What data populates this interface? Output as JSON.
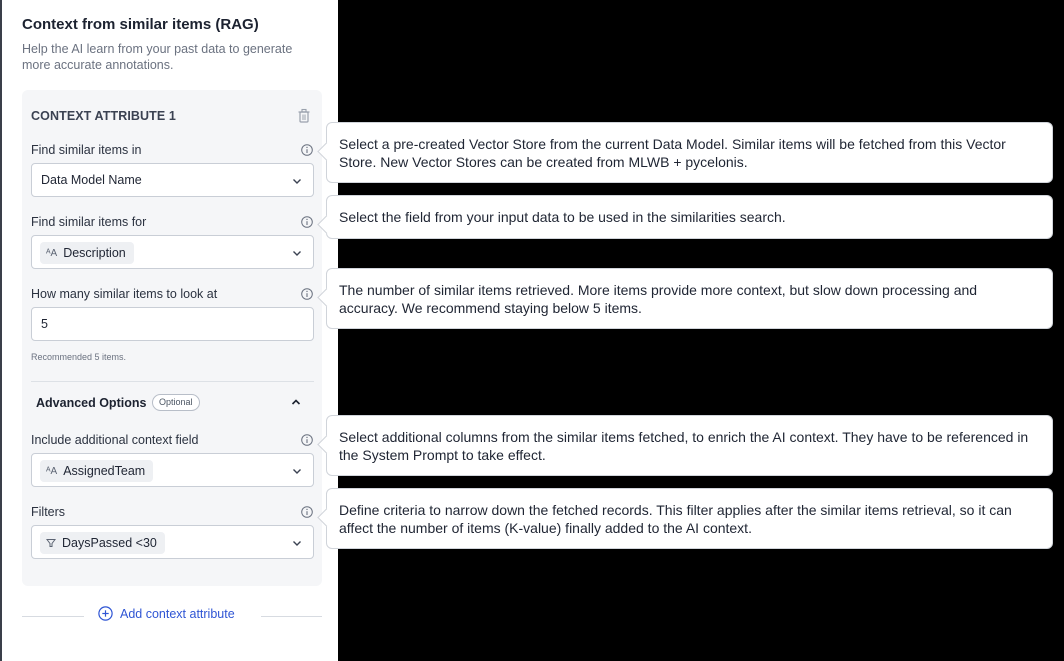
{
  "panel": {
    "title": "Context from similar items (RAG)",
    "description": "Help the AI learn from your past data to generate more accurate annotations."
  },
  "card": {
    "header": "CONTEXT ATTRIBUTE 1",
    "find_in": {
      "label": "Find similar items in",
      "value": "Data Model Name"
    },
    "find_for": {
      "label": "Find similar items for",
      "value": "Description",
      "icon": "text-type-icon"
    },
    "how_many": {
      "label": "How many similar items to look at",
      "value": "5",
      "helper": "Recommended 5 items."
    },
    "advanced": {
      "title": "Advanced Options",
      "badge": "Optional"
    },
    "additional": {
      "label": "Include additional context field",
      "value": "AssignedTeam",
      "icon": "text-type-icon"
    },
    "filters": {
      "label": "Filters",
      "value": "DaysPassed <30",
      "icon": "filter-icon"
    }
  },
  "add_button": {
    "label": "Add context attribute"
  },
  "tooltips": [
    "Select a pre-created Vector Store from the current Data Model. Similar items will be fetched from this Vector Store. New Vector Stores can be created from MLWB + pycelonis.",
    "Select the field from your input data to be used in the similarities search.",
    "The number of similar items retrieved. More items provide more context, but slow down processing and accuracy. We recommend staying below 5 items.",
    "Select additional columns from the similar items fetched, to enrich the AI context. They have to be referenced in the System Prompt to take effect.",
    "Define criteria to narrow down the fetched records. This filter applies after the similar items retrieval, so it can affect the number of items (K-value) finally added to the AI context."
  ],
  "colors": {
    "accent": "#2f55d4",
    "background": "#000000",
    "card": "#f5f6f8"
  }
}
